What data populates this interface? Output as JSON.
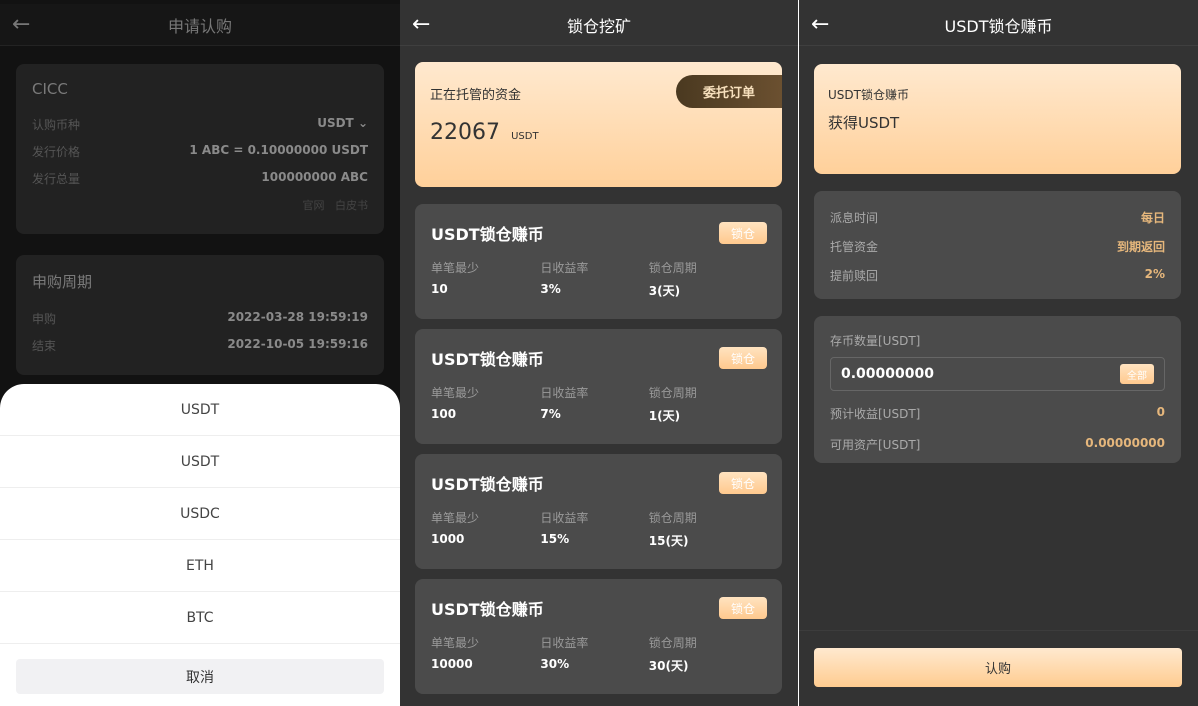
{
  "subscribe": {
    "title": "申请认购",
    "card1": {
      "title": "CICC",
      "rows": [
        {
          "label": "认购币种",
          "value": "USDT"
        },
        {
          "label": "发行价格",
          "value": "1 ABC = 0.10000000 USDT"
        },
        {
          "label": "发行总量",
          "value": "100000000 ABC"
        }
      ],
      "links": [
        "官网",
        "白皮书"
      ]
    },
    "card2": {
      "title": "申购周期",
      "rows": [
        {
          "label": "申购",
          "value": "2022-03-28 19:59:19"
        },
        {
          "label": "结束",
          "value": "2022-10-05 19:59:16"
        }
      ]
    },
    "sheet": {
      "options": [
        "USDT",
        "USDT",
        "USDC",
        "ETH",
        "BTC"
      ],
      "cancel": "取消"
    }
  },
  "mining": {
    "title": "锁仓挖矿",
    "hero": {
      "label": "正在托管的资金",
      "amount": "22067",
      "unit": "USDT",
      "order_button": "委托订单"
    },
    "col_labels": [
      "单笔最少",
      "日收益率",
      "锁仓周期"
    ],
    "lock_label": "锁仓",
    "products": [
      {
        "name": "USDT锁仓赚币",
        "min": "10",
        "rate": "3%",
        "period": "3(天)"
      },
      {
        "name": "USDT锁仓赚币",
        "min": "100",
        "rate": "7%",
        "period": "1(天)"
      },
      {
        "name": "USDT锁仓赚币",
        "min": "1000",
        "rate": "15%",
        "period": "15(天)"
      },
      {
        "name": "USDT锁仓赚币",
        "min": "10000",
        "rate": "30%",
        "period": "30(天)"
      }
    ]
  },
  "detail": {
    "title": "USDT锁仓赚币",
    "hero": {
      "subtitle": "USDT锁仓赚币",
      "headline": "获得USDT"
    },
    "info": [
      {
        "label": "派息时间",
        "value": "每日"
      },
      {
        "label": "托管资金",
        "value": "到期返回"
      },
      {
        "label": "提前赎回",
        "value": "2%"
      }
    ],
    "form": {
      "amount_label": "存币数量[USDT]",
      "amount_value": "0.00000000",
      "all_button": "全部",
      "rows": [
        {
          "label": "预计收益[USDT]",
          "value": "0"
        },
        {
          "label": "可用资产[USDT]",
          "value": "0.00000000"
        }
      ]
    },
    "buy_button": "认购"
  },
  "colors": {
    "accent": "#ffd09a",
    "gold_text": "#e6b77c",
    "panel_bg": "#333333",
    "card_bg": "#4b4b4b"
  }
}
